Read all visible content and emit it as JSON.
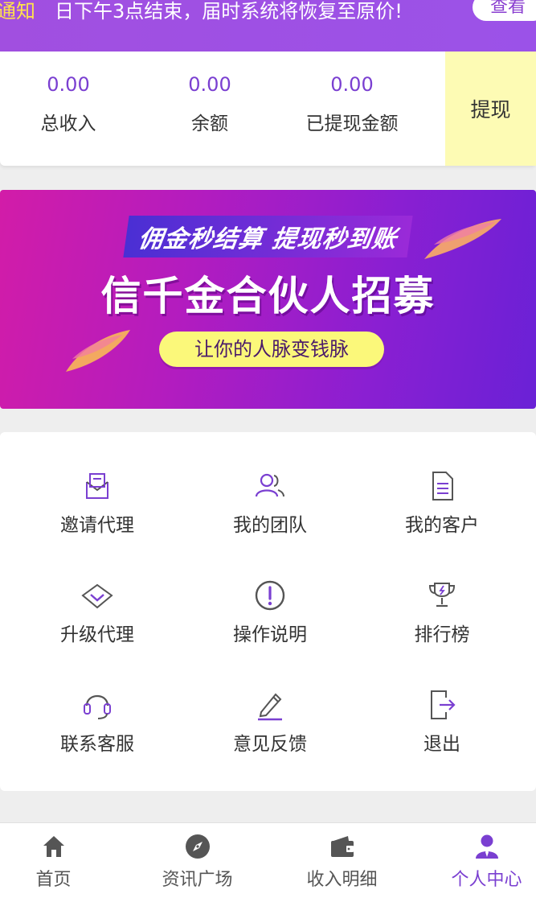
{
  "notice": {
    "tag": "通知",
    "text": "日下午3点结束，届时系统将恢复至原价!",
    "view_label": "查看"
  },
  "stats": {
    "items": [
      {
        "value": "0.00",
        "label": "总收入"
      },
      {
        "value": "0.00",
        "label": "余额"
      },
      {
        "value": "0.00",
        "label": "已提现金额"
      }
    ],
    "withdraw_label": "提现"
  },
  "banner": {
    "subtitle": "佣金秒结算 提现秒到账",
    "title": "信千金合伙人招募",
    "slogan": "让你的人脉变钱脉"
  },
  "menu": {
    "items": [
      {
        "label": "邀请代理",
        "icon": "invite-envelope-icon"
      },
      {
        "label": "我的团队",
        "icon": "team-users-icon"
      },
      {
        "label": "我的客户",
        "icon": "document-icon"
      },
      {
        "label": "升级代理",
        "icon": "diamond-chevron-icon"
      },
      {
        "label": "操作说明",
        "icon": "info-exclamation-icon"
      },
      {
        "label": "排行榜",
        "icon": "trophy-icon"
      },
      {
        "label": "联系客服",
        "icon": "headset-icon"
      },
      {
        "label": "意见反馈",
        "icon": "pencil-icon"
      },
      {
        "label": "退出",
        "icon": "logout-icon"
      }
    ]
  },
  "tabbar": {
    "items": [
      {
        "label": "首页",
        "icon": "home-icon",
        "active": false
      },
      {
        "label": "资讯广场",
        "icon": "compass-icon",
        "active": false
      },
      {
        "label": "收入明细",
        "icon": "wallet-icon",
        "active": false
      },
      {
        "label": "个人中心",
        "icon": "user-icon",
        "active": true
      }
    ]
  },
  "colors": {
    "accent": "#7a3fd1",
    "notice_bg": "#9b52e8",
    "withdraw_bg": "#fdfbb4",
    "slogan_bg": "#fbf87a"
  }
}
